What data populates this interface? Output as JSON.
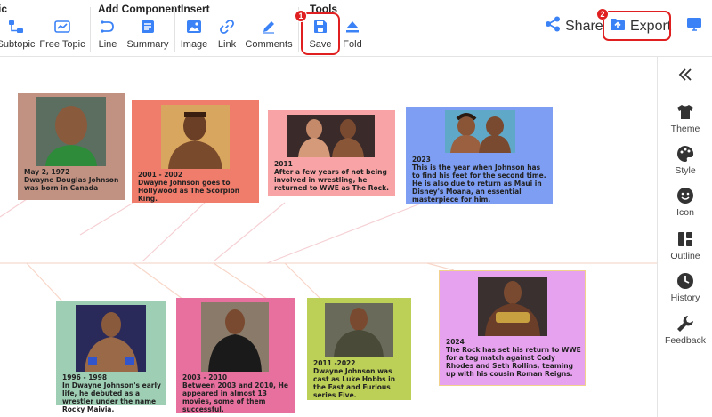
{
  "toolbar": {
    "groups": {
      "topic": "ic",
      "add_component": "Add Component",
      "insert": "Insert",
      "tools": "Tools"
    },
    "tools": {
      "subtopic": "Subtopic",
      "free_topic": "Free Topic",
      "line": "Line",
      "summary": "Summary",
      "image": "Image",
      "link": "Link",
      "comments": "Comments",
      "save": "Save",
      "fold": "Fold"
    },
    "share": "Share",
    "export": "Export",
    "badges": {
      "save": "1",
      "export": "2"
    }
  },
  "sidebar": {
    "items": [
      {
        "label": "Theme",
        "icon": "shirt-icon"
      },
      {
        "label": "Style",
        "icon": "palette-icon"
      },
      {
        "label": "Icon",
        "icon": "smiley-icon"
      },
      {
        "label": "Outline",
        "icon": "outline-icon"
      },
      {
        "label": "History",
        "icon": "clock-icon"
      },
      {
        "label": "Feedback",
        "icon": "wrench-icon"
      }
    ]
  },
  "timeline": {
    "cards": [
      {
        "date": "May 2, 1972",
        "desc": "Dwayne Douglas Johnson was born in Canada",
        "color": "#c19182"
      },
      {
        "date": "2001 - 2002",
        "desc": "Dwayne Johnson goes to Hollywood as The Scorpion King.",
        "color": "#f07c6c"
      },
      {
        "date": "2011",
        "desc": "After a few years of not being involved in wrestling, he returned to WWE as The Rock.",
        "color": "#f8a4a6"
      },
      {
        "date": "2023",
        "desc": "This is the year when Johnson has to find his feet for the second time. He is also due to return as Maui in Disney's Moana, an essential masterpiece for him.",
        "color": "#7e9ef3"
      },
      {
        "date": "1996 - 1998",
        "desc": "In Dwayne Johnson's early life, he debuted as a wrestler under the name Rocky Maivia.",
        "color": "#9ecfb4"
      },
      {
        "date": "2003 - 2010",
        "desc": "Between 2003 and 2010, He appeared in almost 13 movies, some of them successful.",
        "color": "#e7709e"
      },
      {
        "date": "2011 -2022",
        "desc": "Dwayne Johnson was cast as Luke Hobbs in the Fast and Furious series Five.",
        "color": "#bccf56"
      },
      {
        "date": "2024",
        "desc": "The Rock has set his return to WWE for a tag match against Cody Rhodes and Seth Rollins, teaming up with his cousin Roman Reigns.",
        "color": "#e6a1ef"
      }
    ]
  }
}
